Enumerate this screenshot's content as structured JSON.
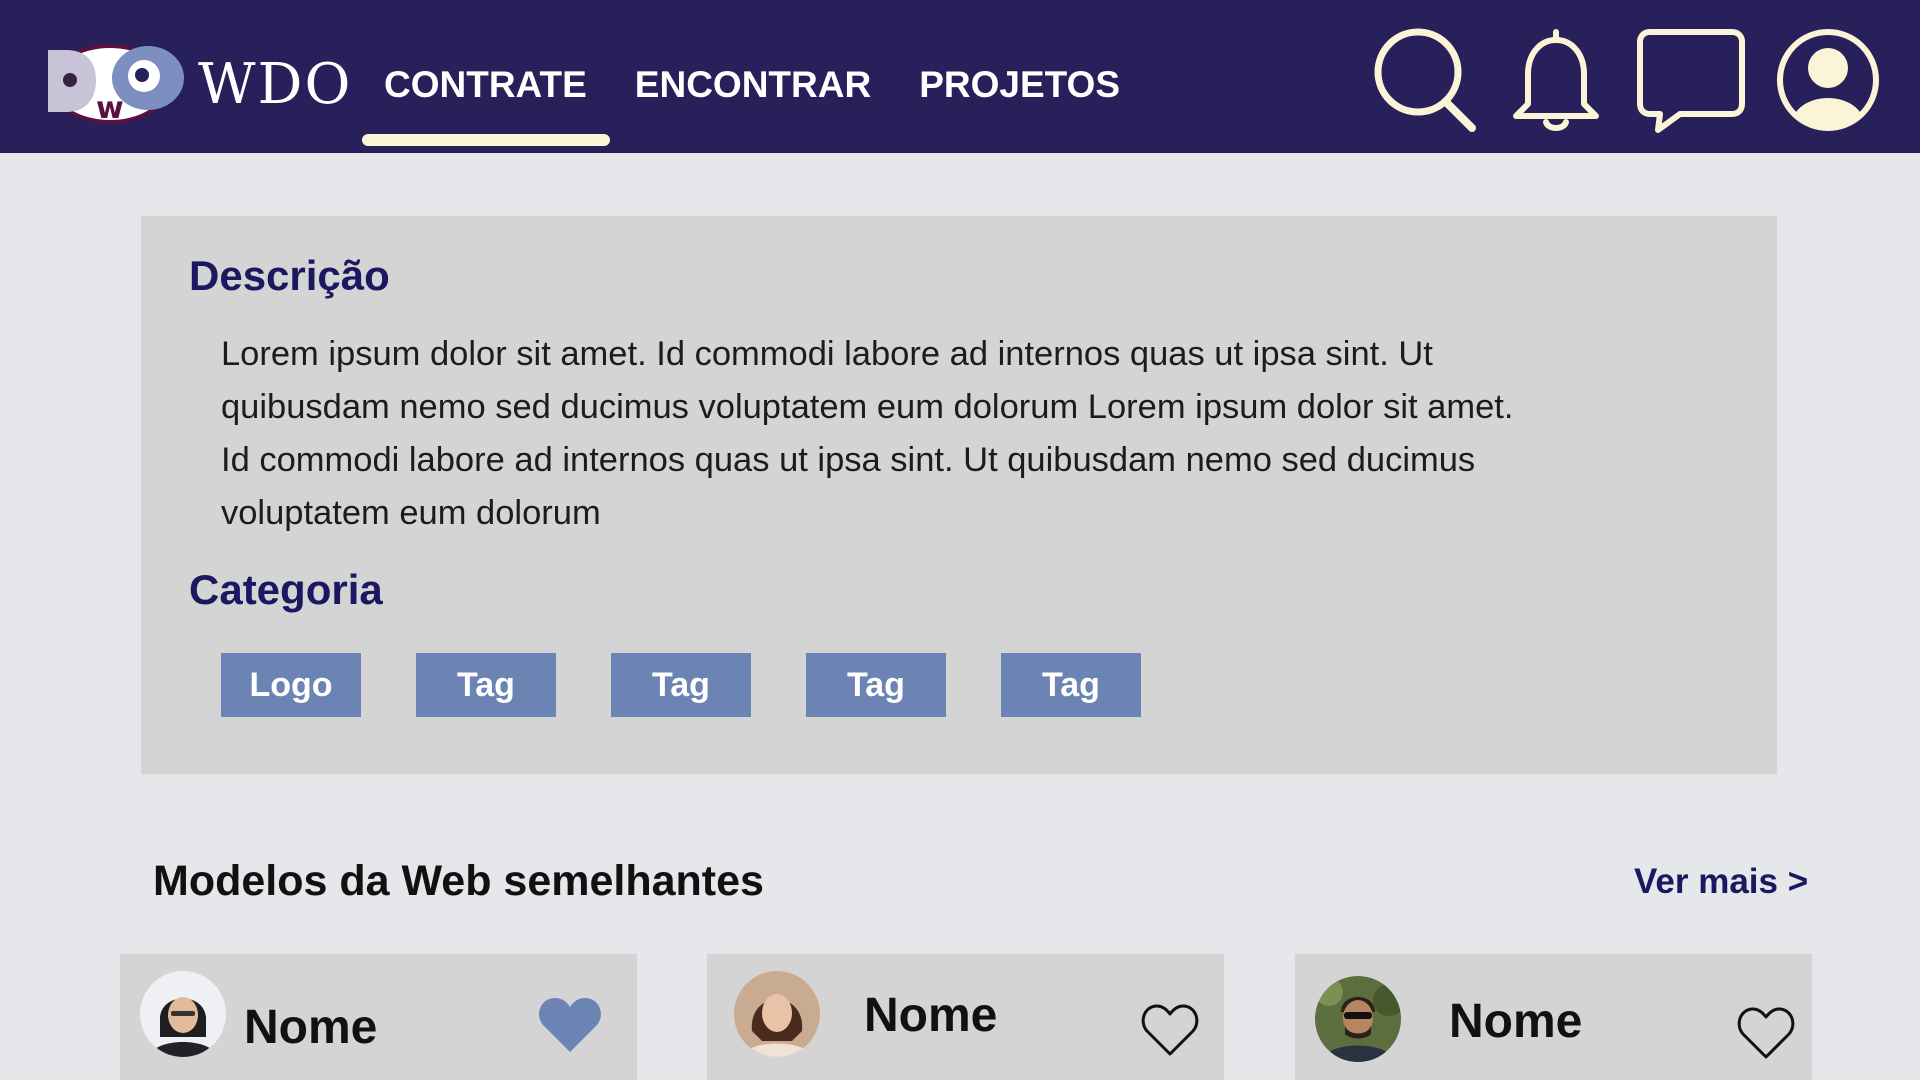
{
  "header": {
    "brand": "WDO",
    "logo_text": "DWO",
    "nav": [
      {
        "label": "CONTRATE",
        "active": true
      },
      {
        "label": "ENCONTRAR",
        "active": false
      },
      {
        "label": "PROJETOS",
        "active": false
      }
    ],
    "icons": [
      "search-icon",
      "bell-icon",
      "chat-icon",
      "user-icon"
    ]
  },
  "description": {
    "title": "Descrição",
    "lines": [
      "Lorem ipsum dolor sit amet. Id commodi labore ad internos quas ut ipsa sint. Ut",
      "quibusdam nemo sed ducimus voluptatem eum dolorum Lorem ipsum dolor sit amet.",
      "Id commodi labore ad internos quas ut ipsa sint. Ut quibusdam nemo sed ducimus",
      "voluptatem eum dolorum"
    ]
  },
  "category": {
    "title": "Categoria",
    "tags": [
      "Logo",
      "Tag",
      "Tag",
      "Tag",
      "Tag"
    ]
  },
  "similar": {
    "title": "Modelos da Web semelhantes",
    "see_more": "Ver mais >",
    "cards": [
      {
        "name": "Nome",
        "favorited": true
      },
      {
        "name": "Nome",
        "favorited": false
      },
      {
        "name": "Nome",
        "favorited": false
      }
    ]
  },
  "colors": {
    "header_bg": "#27205a",
    "accent_cream": "#fbf4d6",
    "tag_blue": "#6c84b4",
    "title_navy": "#1b1760",
    "panel_gray": "#d4d4d4",
    "page_bg": "#e6e7eb"
  }
}
